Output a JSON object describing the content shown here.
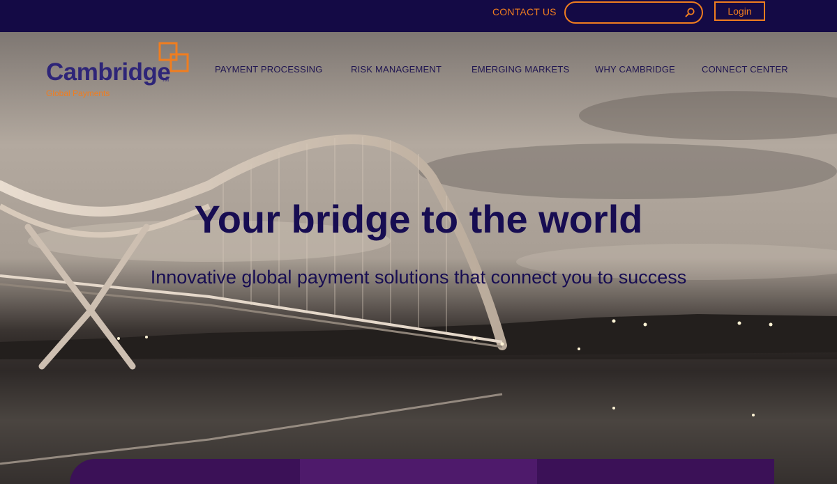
{
  "topbar": {
    "contact_label": "CONTACT US",
    "search_placeholder": "",
    "login_label": "Login"
  },
  "logo": {
    "name": "Cambridge",
    "trademark": "TM",
    "tagline": "Global Payments"
  },
  "nav": {
    "items": [
      {
        "label": "PAYMENT PROCESSING"
      },
      {
        "label": "RISK MANAGEMENT"
      },
      {
        "label": "EMERGING MARKETS"
      },
      {
        "label": "WHY CAMBRIDGE"
      },
      {
        "label": "CONNECT CENTER"
      }
    ]
  },
  "hero": {
    "headline": "Your bridge to the world",
    "subheadline": "Innovative global payment solutions that connect you to success"
  },
  "colors": {
    "topbar": "#140a45",
    "accent": "#f07d1f",
    "brand_purple": "#2e2578",
    "headline": "#170d52"
  },
  "icons": [
    "search-icon",
    "cambridge-logo-mark"
  ]
}
